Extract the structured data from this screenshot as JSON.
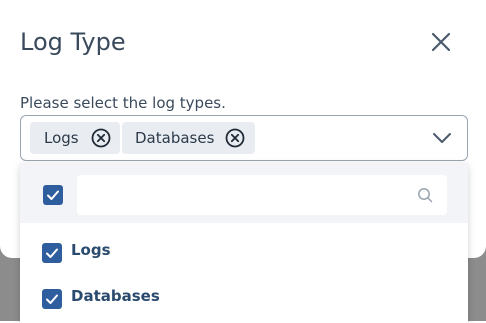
{
  "modal": {
    "title": "Log Type",
    "helper_text": "Please select the log types.",
    "close_icon": "close-icon"
  },
  "select": {
    "chips": [
      {
        "label": "Logs",
        "remove_icon": "circle-x-icon"
      },
      {
        "label": "Databases",
        "remove_icon": "circle-x-icon"
      }
    ],
    "toggle_icon": "chevron-down-icon"
  },
  "dropdown": {
    "select_all_checked": true,
    "search": {
      "value": "",
      "placeholder": "",
      "icon": "search-icon"
    },
    "options": [
      {
        "label": "Logs",
        "checked": true
      },
      {
        "label": "Databases",
        "checked": true
      }
    ]
  },
  "colors": {
    "accent": "#2f5e9e",
    "title_text": "#3a4a5c",
    "option_text": "#2a4a6e",
    "chip_bg": "#e9edf2",
    "backdrop": "#8c8c8c"
  }
}
